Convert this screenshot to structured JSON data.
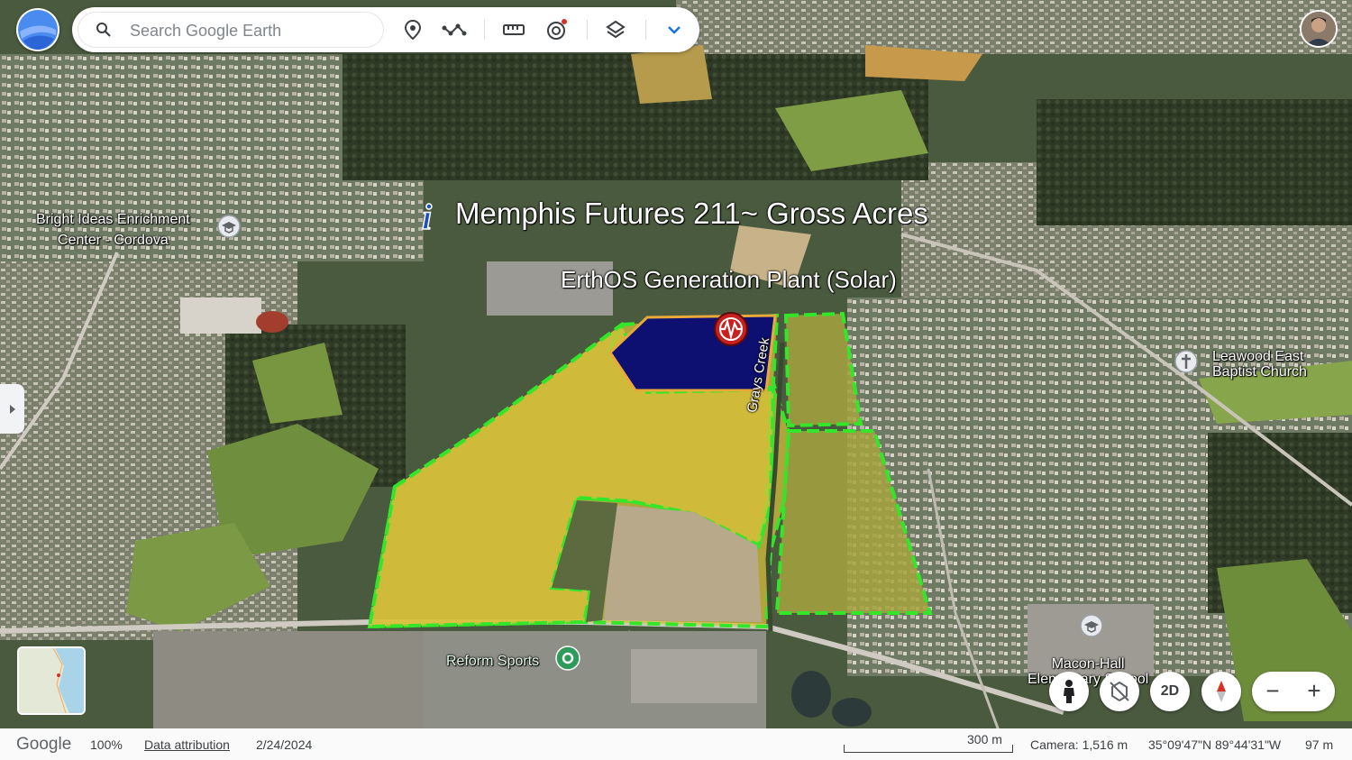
{
  "search": {
    "placeholder": "Search Google Earth"
  },
  "toolbar": {
    "icons": [
      "search-icon",
      "place-marker-icon",
      "path-icon",
      "ruler-icon",
      "voyager-icon",
      "layers-icon",
      "chevron-down-icon"
    ]
  },
  "map": {
    "title_label": "Memphis Futures 211~ Gross Acres",
    "plant_label": "ErthOS Generation Plant (Solar)",
    "creek_label": "Grays Creek",
    "places": {
      "bright_ideas_line1": "Bright Ideas Enrichment",
      "bright_ideas_line2": "Center - Cordova",
      "leawood_line1": "Leawood East",
      "leawood_line2": "Baptist Church",
      "reform_sports": "Reform Sports",
      "macon_hall_line1": "Macon-Hall",
      "macon_hall_line2": "Elementary School"
    }
  },
  "controls": {
    "view_mode_label": "2D",
    "zoom_out_label": "−",
    "zoom_in_label": "+"
  },
  "status": {
    "brand": "Google",
    "zoom": "100%",
    "attribution": "Data attribution",
    "date": "2/24/2024",
    "scale_label": "300 m",
    "camera": "Camera: 1,516 m",
    "coordinates": "35°09'47\"N 89°44'31\"W",
    "elevation": "97 m"
  },
  "colors": {
    "parcel_fill": "#d9c13a",
    "parcel_border": "#33e62a",
    "plant_fill": "#0d1070",
    "plant_border": "#e8a93a"
  }
}
